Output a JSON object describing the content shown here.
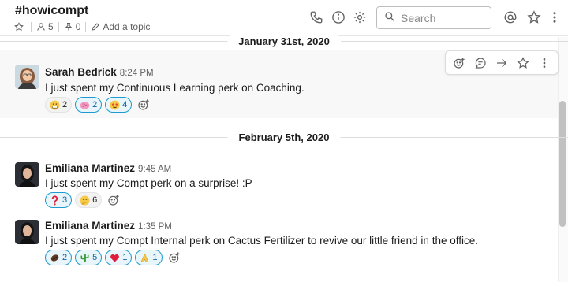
{
  "channel": {
    "name": "#howicompt",
    "member_count": "5",
    "pinned_count": "0",
    "topic_label": "Add a topic"
  },
  "search": {
    "placeholder": "Search"
  },
  "dividers": [
    "January 31st, 2020",
    "February 5th, 2020"
  ],
  "messages": [
    {
      "author": "Sarah Bedrick",
      "time": "8:24 PM",
      "text": "I just spent my Continuous Learning perk on Coaching.",
      "reactions": [
        {
          "emoji": "grimace-emoji",
          "count": "2",
          "mine": false
        },
        {
          "emoji": "brain-emoji",
          "count": "2",
          "mine": true
        },
        {
          "emoji": "star-struck-emoji",
          "count": "4",
          "mine": true
        }
      ]
    },
    {
      "author": "Emiliana Martinez",
      "time": "9:45 AM",
      "text": "I just spent my Compt perk on a surprise! :P",
      "reactions": [
        {
          "emoji": "question-emoji",
          "count": "3",
          "mine": true
        },
        {
          "emoji": "thinking-emoji",
          "count": "6",
          "mine": false
        }
      ]
    },
    {
      "author": "Emiliana Martinez",
      "time": "1:35 PM",
      "text": "I just spent my Compt Internal perk on Cactus Fertilizer to revive our little friend in the office.",
      "reactions": [
        {
          "emoji": "bean-emoji",
          "count": "2",
          "mine": true
        },
        {
          "emoji": "cactus-emoji",
          "count": "5",
          "mine": true
        },
        {
          "emoji": "heart-emoji",
          "count": "1",
          "mine": true
        },
        {
          "emoji": "pray-emoji",
          "count": "1",
          "mine": true
        }
      ]
    }
  ],
  "colors": {
    "accent": "#1264a3",
    "reaction_mine_bg": "#e8f5fa",
    "reaction_mine_border": "#1d9bd1",
    "hover_bg": "#f8f8f8"
  }
}
